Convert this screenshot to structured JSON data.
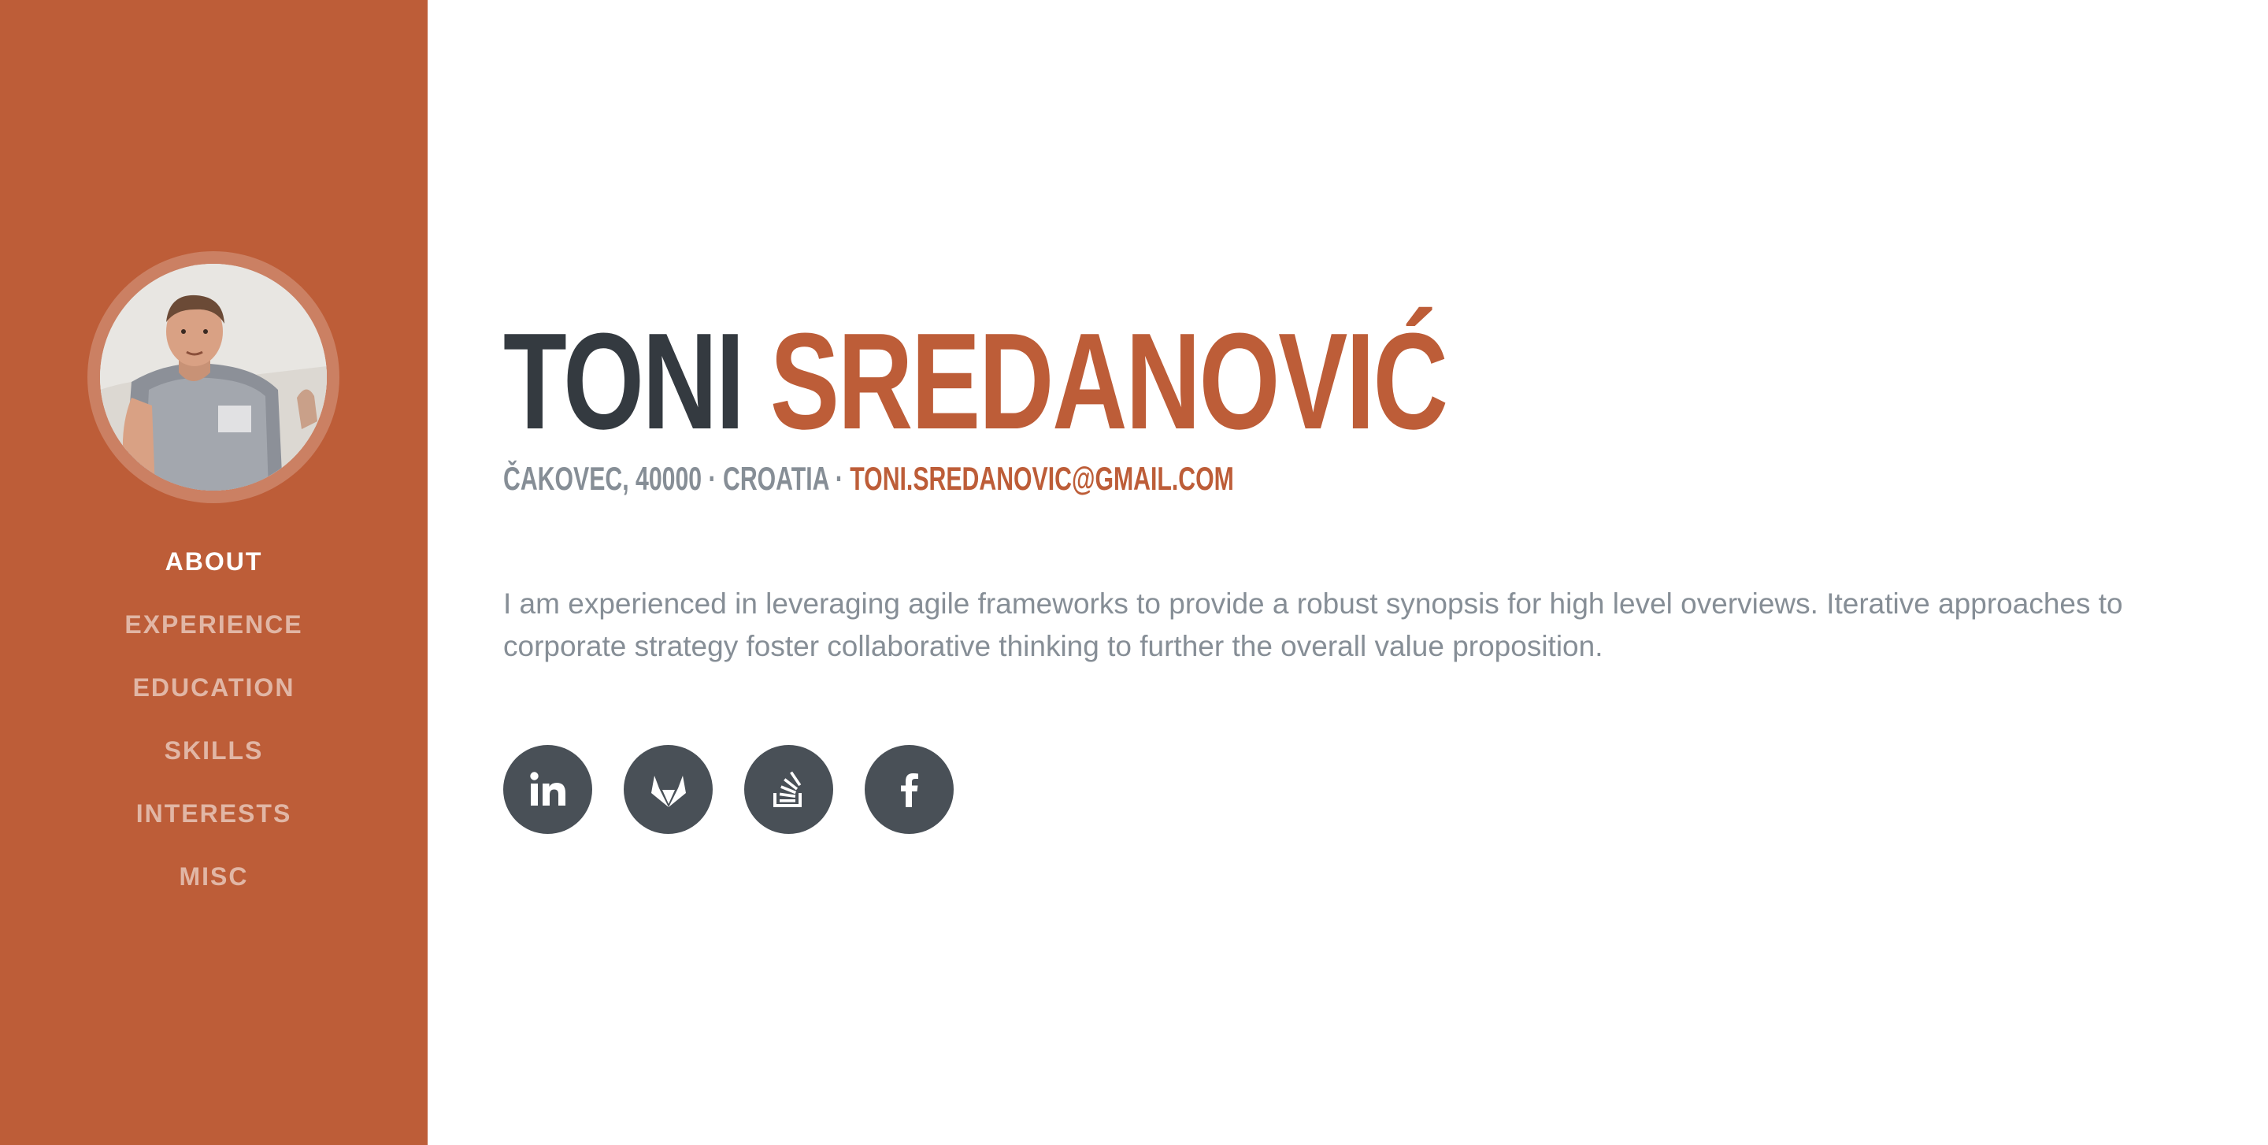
{
  "sidebar": {
    "nav": [
      {
        "label": "ABOUT",
        "active": true
      },
      {
        "label": "EXPERIENCE",
        "active": false
      },
      {
        "label": "EDUCATION",
        "active": false
      },
      {
        "label": "SKILLS",
        "active": false
      },
      {
        "label": "INTERESTS",
        "active": false
      },
      {
        "label": "MISC",
        "active": false
      }
    ]
  },
  "about": {
    "first_name": "TONI",
    "last_name": "SREDANOVIĆ",
    "address": "ČAKOVEC, 40000 · CROATIA · ",
    "email": "TONI.SREDANOVIC@GMAIL.COM",
    "lead": "I am experienced in leveraging agile frameworks to provide a robust synopsis for high level overviews. Iterative approaches to corporate strategy foster collaborative thinking to further the overall value proposition."
  },
  "social": [
    {
      "icon": "linkedin-icon"
    },
    {
      "icon": "gitlab-icon"
    },
    {
      "icon": "stackoverflow-icon"
    },
    {
      "icon": "facebook-icon"
    }
  ],
  "colors": {
    "primary": "#bd5d38",
    "heading": "#343a40",
    "muted": "#868e96",
    "social_bg": "#495057"
  }
}
